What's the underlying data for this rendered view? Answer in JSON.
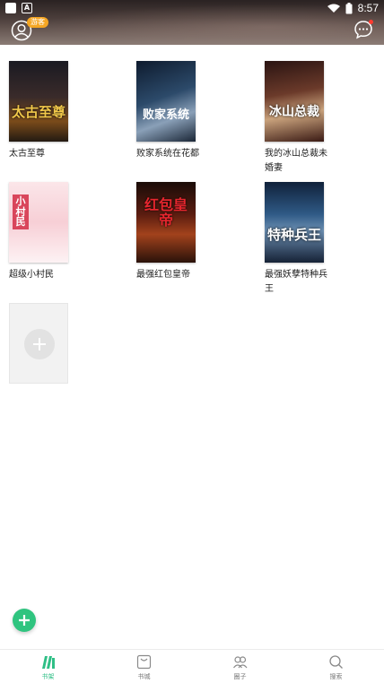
{
  "status_bar": {
    "time": "8:57"
  },
  "header": {
    "vip_badge": "游客"
  },
  "shelf": {
    "books": [
      {
        "title": "太古至尊",
        "cover_text": "太古至尊"
      },
      {
        "title": "败家系统在花都",
        "cover_text": "败家系统"
      },
      {
        "title": "我的冰山总裁未婚妻",
        "cover_text": "冰山总裁"
      },
      {
        "title": "超级小村民",
        "cover_text": "小村民"
      },
      {
        "title": "最强红包皇帝",
        "cover_text": "红包皇帝"
      },
      {
        "title": "最强妖孽特种兵王",
        "cover_text": "特种兵王"
      }
    ]
  },
  "bottom_nav": {
    "items": [
      {
        "label": "书架",
        "icon": "bookshelf-icon",
        "active": true
      },
      {
        "label": "书城",
        "icon": "bookstore-icon",
        "active": false
      },
      {
        "label": "圈子",
        "icon": "community-icon",
        "active": false
      },
      {
        "label": "搜索",
        "icon": "search-icon",
        "active": false
      }
    ]
  },
  "colors": {
    "accent": "#2fc47f",
    "badge": "#f5a623",
    "notification_dot": "#ff3b30"
  }
}
